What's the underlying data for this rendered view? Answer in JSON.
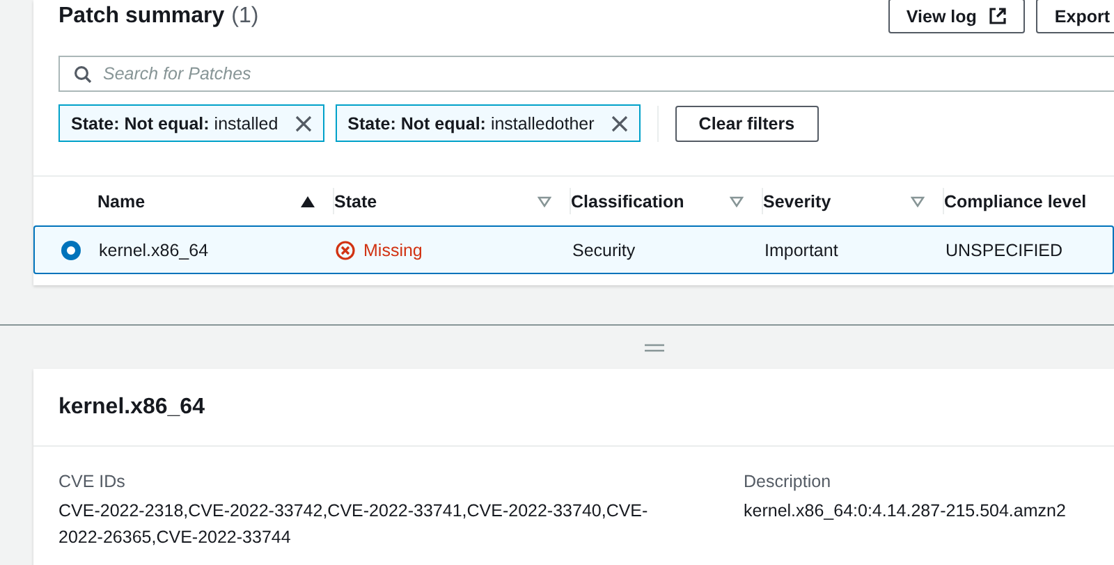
{
  "panel": {
    "title": "Patch summary",
    "count": "(1)",
    "buttons": [
      {
        "label": "View log",
        "kind": "external"
      },
      {
        "label": "Export",
        "kind": "plain"
      }
    ]
  },
  "search": {
    "placeholder": "Search for Patches"
  },
  "filters": [
    {
      "property": "State: Not equal:",
      "value": "installed"
    },
    {
      "property": "State: Not equal:",
      "value": "installedother"
    }
  ],
  "clear_button": "Clear filters",
  "table": {
    "columns": [
      {
        "label": "Name",
        "sorted": true
      },
      {
        "label": "State",
        "sorted": false
      },
      {
        "label": "Classification",
        "sorted": false
      },
      {
        "label": "Severity",
        "sorted": false
      },
      {
        "label": "Compliance level"
      }
    ],
    "rows": [
      {
        "selected": true,
        "name": "kernel.x86_64",
        "state": {
          "text": "Missing",
          "kind": "error"
        },
        "classification": "Security",
        "severity": "Important",
        "compliance": "UNSPECIFIED"
      }
    ]
  },
  "details": {
    "title": "kernel.x86_64",
    "fields": [
      {
        "label": "CVE IDs",
        "value": "CVE-2022-2318,CVE-2022-33742,CVE-2022-33741,CVE-2022-33740,CVE-2022-26365,CVE-2022-33744"
      },
      {
        "label": "Description",
        "value": "kernel.x86_64:0:4.14.287-215.504.amzn2"
      }
    ]
  }
}
